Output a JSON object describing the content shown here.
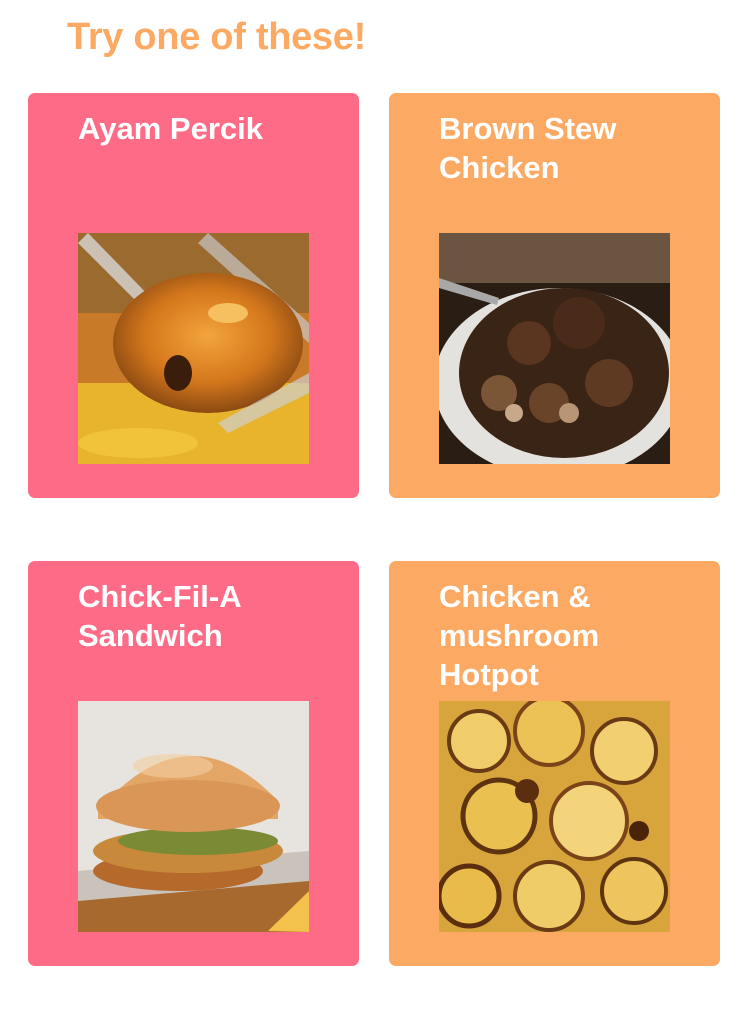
{
  "heading": "Try one of these!",
  "colors": {
    "heading": "#fcaa63",
    "card_pink": "#fe6b86",
    "card_orange": "#fcaa63",
    "card_text": "#ffffff"
  },
  "recipes": [
    {
      "title": "Ayam Percik",
      "image": "ayam-percik-photo",
      "color": "pink"
    },
    {
      "title": "Brown Stew Chicken",
      "image": "brown-stew-chicken-photo",
      "color": "orange"
    },
    {
      "title": "Chick-Fil-A Sandwich",
      "image": "chick-fil-a-sandwich-photo",
      "color": "pink"
    },
    {
      "title": "Chicken & mushroom Hotpot",
      "image": "chicken-mushroom-hotpot-photo",
      "color": "orange"
    }
  ]
}
